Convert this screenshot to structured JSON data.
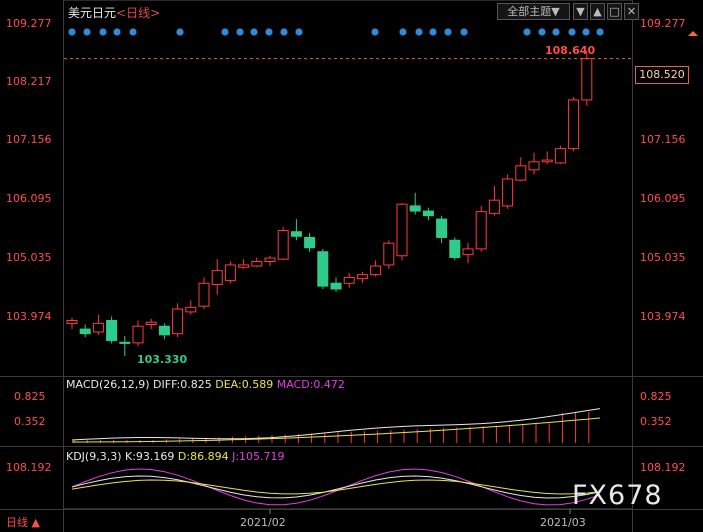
{
  "header": {
    "symbol": "美元日元",
    "period_tag": "<日线>",
    "theme_selector": "全部主题▼"
  },
  "price_axis": {
    "ticks": [
      "109.277",
      "108.217",
      "107.156",
      "106.095",
      "105.035",
      "103.974"
    ]
  },
  "current_price": "108.520",
  "high_label": "108.640",
  "low_label": "103.330",
  "macd": {
    "label": "MACD(26,12,9)",
    "diff": "DIFF:0.825",
    "dea": "DEA:0.589",
    "macd": "MACD:0.472",
    "ticks": [
      "0.825",
      "0.352"
    ]
  },
  "kdj": {
    "label": "KDJ(9,3,3)",
    "k": "K:93.169",
    "d": "D:86.894",
    "j": "J:105.719",
    "tick": "108.192"
  },
  "x_axis": {
    "labels": [
      "2021/02",
      "2021/03"
    ]
  },
  "bottom_tab": "日线 ▲",
  "watermark": "FX678",
  "colors": {
    "up": "#ff3b3b",
    "down": "#2ecc8a",
    "k_line": "#e8e8e8",
    "d_line": "#e8e44a",
    "j_line": "#e040e0",
    "dot": "#2e8bd8"
  },
  "chart_data": {
    "type": "candlestick",
    "ylim": [
      103.4,
      109.3
    ],
    "candles": [
      {
        "o": 103.9,
        "c": 103.95,
        "h": 104.0,
        "l": 103.8
      },
      {
        "o": 103.8,
        "c": 103.72,
        "h": 103.88,
        "l": 103.66
      },
      {
        "o": 103.75,
        "c": 103.9,
        "h": 104.05,
        "l": 103.7
      },
      {
        "o": 103.95,
        "c": 103.6,
        "h": 104.02,
        "l": 103.55
      },
      {
        "o": 103.57,
        "c": 103.55,
        "h": 103.68,
        "l": 103.33
      },
      {
        "o": 103.56,
        "c": 103.85,
        "h": 103.95,
        "l": 103.5
      },
      {
        "o": 103.88,
        "c": 103.92,
        "h": 103.98,
        "l": 103.8
      },
      {
        "o": 103.85,
        "c": 103.7,
        "h": 103.9,
        "l": 103.62
      },
      {
        "o": 103.72,
        "c": 104.15,
        "h": 104.25,
        "l": 103.66
      },
      {
        "o": 104.1,
        "c": 104.18,
        "h": 104.3,
        "l": 104.05
      },
      {
        "o": 104.2,
        "c": 104.6,
        "h": 104.7,
        "l": 104.15
      },
      {
        "o": 104.58,
        "c": 104.82,
        "h": 105.02,
        "l": 104.4
      },
      {
        "o": 104.65,
        "c": 104.92,
        "h": 104.98,
        "l": 104.6
      },
      {
        "o": 104.88,
        "c": 104.92,
        "h": 105.02,
        "l": 104.85
      },
      {
        "o": 104.9,
        "c": 104.98,
        "h": 105.05,
        "l": 104.88
      },
      {
        "o": 104.98,
        "c": 105.04,
        "h": 105.08,
        "l": 104.9
      },
      {
        "o": 105.02,
        "c": 105.52,
        "h": 105.58,
        "l": 105.0
      },
      {
        "o": 105.5,
        "c": 105.42,
        "h": 105.72,
        "l": 105.35
      },
      {
        "o": 105.4,
        "c": 105.22,
        "h": 105.48,
        "l": 105.15
      },
      {
        "o": 105.15,
        "c": 104.55,
        "h": 105.2,
        "l": 104.5
      },
      {
        "o": 104.6,
        "c": 104.5,
        "h": 104.7,
        "l": 104.45
      },
      {
        "o": 104.6,
        "c": 104.7,
        "h": 104.78,
        "l": 104.52
      },
      {
        "o": 104.68,
        "c": 104.75,
        "h": 104.8,
        "l": 104.6
      },
      {
        "o": 104.75,
        "c": 104.9,
        "h": 105.0,
        "l": 104.72
      },
      {
        "o": 104.92,
        "c": 105.3,
        "h": 105.35,
        "l": 104.85
      },
      {
        "o": 105.08,
        "c": 105.98,
        "h": 106.0,
        "l": 105.0
      },
      {
        "o": 105.95,
        "c": 105.86,
        "h": 106.18,
        "l": 105.8
      },
      {
        "o": 105.86,
        "c": 105.78,
        "h": 105.92,
        "l": 105.7
      },
      {
        "o": 105.72,
        "c": 105.4,
        "h": 105.78,
        "l": 105.3
      },
      {
        "o": 105.35,
        "c": 105.05,
        "h": 105.4,
        "l": 105.0
      },
      {
        "o": 105.1,
        "c": 105.2,
        "h": 105.3,
        "l": 104.95
      },
      {
        "o": 105.2,
        "c": 105.85,
        "h": 105.95,
        "l": 105.15
      },
      {
        "o": 105.82,
        "c": 106.05,
        "h": 106.3,
        "l": 105.78
      },
      {
        "o": 105.95,
        "c": 106.42,
        "h": 106.5,
        "l": 105.9
      },
      {
        "o": 106.4,
        "c": 106.65,
        "h": 106.8,
        "l": 106.38
      },
      {
        "o": 106.58,
        "c": 106.72,
        "h": 106.88,
        "l": 106.5
      },
      {
        "o": 106.72,
        "c": 106.75,
        "h": 106.9,
        "l": 106.68
      },
      {
        "o": 106.7,
        "c": 106.95,
        "h": 107.0,
        "l": 106.68
      },
      {
        "o": 106.95,
        "c": 107.8,
        "h": 107.85,
        "l": 106.9
      },
      {
        "o": 107.8,
        "c": 108.52,
        "h": 108.64,
        "l": 107.7
      }
    ]
  }
}
